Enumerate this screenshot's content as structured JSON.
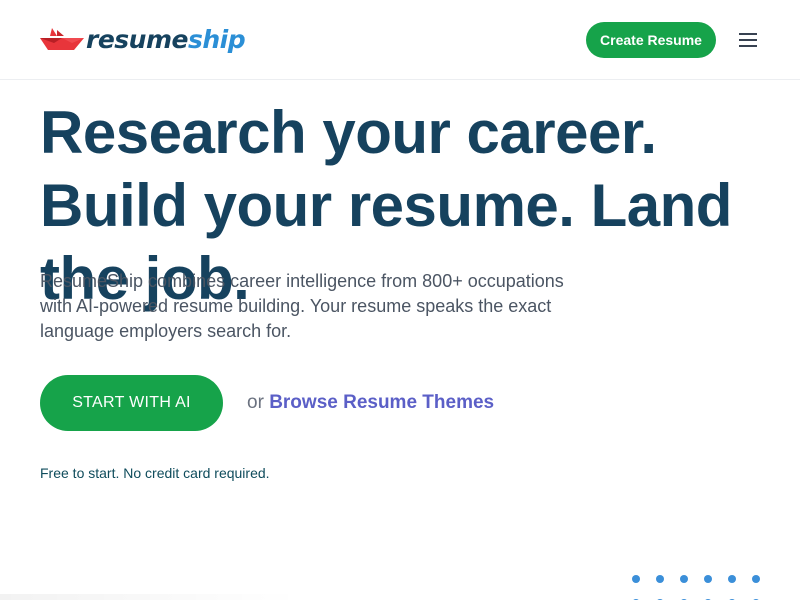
{
  "header": {
    "logo": {
      "text_part1": "resume",
      "text_part2": "ship",
      "icon": "paper-boat-icon"
    },
    "create_button_label": "Create Resume",
    "menu_icon": "hamburger-menu-icon"
  },
  "hero": {
    "title": "Research your career. Build your resume. Land the job.",
    "subtitle": "ResumeShip combines career intelligence from 800+ occupations with AI-powered resume building. Your resume speaks the exact language employers search for.",
    "cta_label": "START WITH AI",
    "or_text": "or",
    "browse_link": "Browse Resume Themes",
    "note": "Free to start. No credit card required."
  },
  "colors": {
    "brand_navy": "#16425e",
    "brand_blue": "#2b8fd6",
    "primary_green": "#16a34a",
    "link_purple": "#5b5fc7",
    "logo_red": "#e8353b",
    "dots_blue": "#3b8fd9"
  }
}
